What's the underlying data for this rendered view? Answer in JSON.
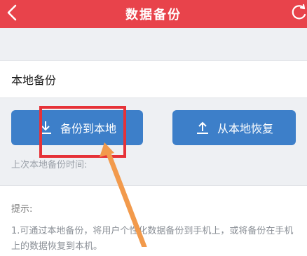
{
  "header": {
    "title": "数据备份",
    "back_icon": "chevron-left-icon",
    "refresh_icon": "refresh-icon",
    "bg_color": "#e8434b"
  },
  "local_backup": {
    "section_label": "本地备份",
    "backup_button_label": "备份到本地",
    "restore_button_label": "从本地恢复",
    "backup_icon": "download-icon",
    "restore_icon": "upload-icon",
    "last_backup_text": "上次本地备份时间:",
    "button_color": "#3d7fc9"
  },
  "tips": {
    "title": "提示:",
    "text": "1.可通过本地备份，将用户个性化数据备份到手机上，或将备份在手机上的数据恢复到本机。"
  },
  "annotation": {
    "box_color": "#e63238",
    "arrow_color": "#f29a4c"
  }
}
